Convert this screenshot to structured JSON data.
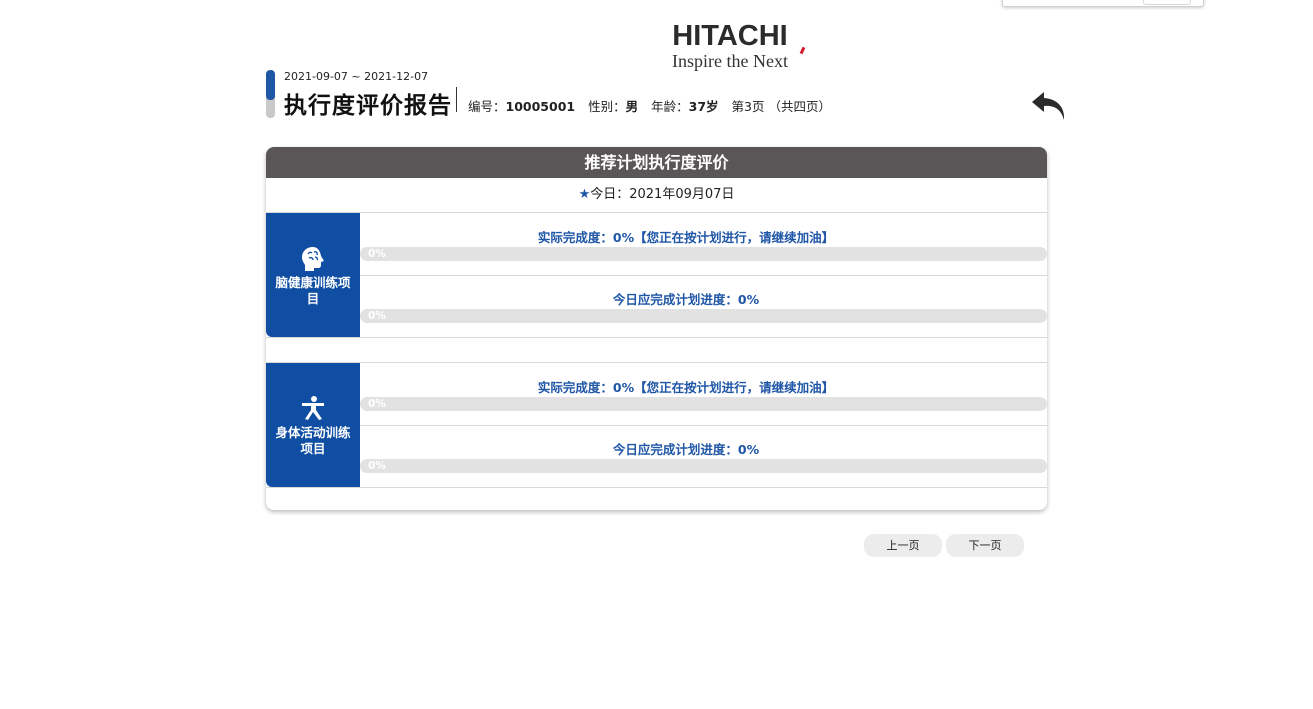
{
  "logo": {
    "brand": "HITACHI",
    "tagline": "Inspire the Next"
  },
  "header": {
    "date_range": "2021-09-07 ~ 2021-12-07",
    "title": "执行度评价报告",
    "id_label": "编号：",
    "id_value": "10005001",
    "gender_label": "性别：",
    "gender_value": "男",
    "age_label": "年龄：",
    "age_value": "37岁",
    "page_info": "第3页 （共四页）"
  },
  "card": {
    "title": "推荐计划执行度评价",
    "today_star": "★",
    "today_text": "今日：2021年09月07日",
    "sections": [
      {
        "label": "脑健康训练项目",
        "icon": "brain-head-icon",
        "actual_text": "实际完成度：0%【您正在按计划进行，请继续加油】",
        "actual_progress": "0%",
        "planned_text": "今日应完成计划进度：0%",
        "planned_progress": "0%"
      },
      {
        "label": "身体活动训练项目",
        "icon": "exercise-person-icon",
        "actual_text": "实际完成度：0%【您正在按计划进行，请继续加油】",
        "actual_progress": "0%",
        "planned_text": "今日应完成计划进度：0%",
        "planned_progress": "0%"
      }
    ]
  },
  "nav": {
    "prev_label": "上一页",
    "next_label": "下一页"
  },
  "colors": {
    "accent": "#1f56a6",
    "title_bar": "#5a5556",
    "progress_track": "#e2e2e2"
  }
}
